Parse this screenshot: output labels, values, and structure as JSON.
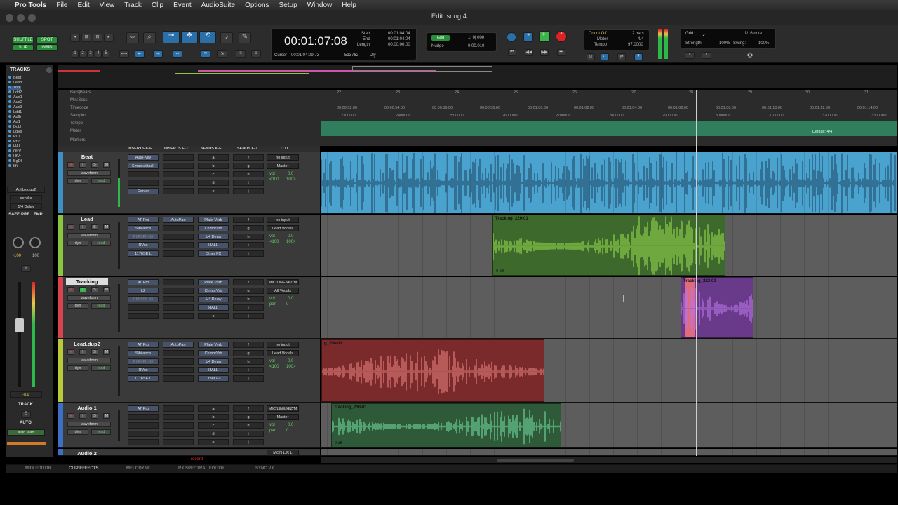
{
  "menubar": {
    "app_name": "Pro Tools",
    "items": [
      "File",
      "Edit",
      "View",
      "Track",
      "Clip",
      "Event",
      "AudioSuite",
      "Options",
      "Setup",
      "Window",
      "Help"
    ]
  },
  "window": {
    "title": "Edit: song 4"
  },
  "toolbar": {
    "shuffle": "SHUFFLE",
    "spot": "SPOT",
    "slip": "SLIP",
    "grid": "GRID",
    "main_counter": "00:01:07:08",
    "start_label": "Start",
    "end_label": "End",
    "length_label": "Length",
    "start": "00:01:04:04",
    "end": "00:01:04:04",
    "length": "00:00:00:00",
    "cursor_label": "Cursor",
    "cursor": "00:01:04:09.73",
    "sample": "513762",
    "dly": "Dly",
    "grid_label": "Grid",
    "grid_value": "1| 0| 000",
    "nudge_label": "Nudge",
    "nudge_value": "0:00.010",
    "count_off": "Count Off",
    "meter_label": "Meter",
    "tempo_label": "Tempo",
    "bars": "2 bars",
    "meter": "4/4",
    "tempo": "97.0000",
    "grid2_label": "Grid:",
    "grid2_value": "1/16 note",
    "strength_label": "Strength:",
    "strength": "100%",
    "swing_label": "Swing:",
    "swing": "100%",
    "nums": [
      "1",
      "2",
      "3",
      "4",
      "5"
    ]
  },
  "tracklist": {
    "header": "TRACKS",
    "items": [
      "Beat",
      "Lead",
      "Trck",
      "Ldd2",
      "Aud1",
      "Aud2",
      "Aud3",
      "Ldd1",
      "Adlb",
      "Ad1",
      "Dobl",
      "LdVs",
      "PCL",
      "PtVr",
      "HAL",
      "OhV",
      "HfVr",
      "BgDl",
      "f/fil"
    ]
  },
  "mixstrip": {
    "name": "Adlibs.dup2",
    "send": "send c",
    "delay": "1/4 Delay",
    "safe": "SAFE",
    "pre": "PRE",
    "fmp": "FMP",
    "pan_l": "-100",
    "pan_r": "100",
    "m": "M",
    "fader_value": "-8.9",
    "track_label": "TRACK",
    "s": "S",
    "auto": "AUTO",
    "auto_read": "auto read"
  },
  "rulers": {
    "labels": [
      "Bars|Beats",
      "Min:Secs",
      "Timecode",
      "Samples",
      "Tempo",
      "Meter",
      "Markers"
    ],
    "bars": [
      "22",
      "23",
      "24",
      "25",
      "26",
      "27",
      "28",
      "29",
      "30",
      "31"
    ],
    "timecode": [
      "00:00:52:00",
      "00:00:54:00",
      "00:00:56:00",
      "00:00:58:00",
      "00:01:00:00",
      "00:01:02:00",
      "00:01:04:00",
      "00:01:06:00",
      "00:01:08:00",
      "00:01:10:00",
      "00:01:12:00",
      "00:01:14:00"
    ],
    "samples": [
      "2300000",
      "2400000",
      "2500000",
      "2600000",
      "2700000",
      "2800000",
      "2900000",
      "3000000",
      "3100000",
      "3200000",
      "3300000"
    ],
    "meter_default": "Default: 4/4"
  },
  "columns": {
    "inserts_ae": "INSERTS A-E",
    "inserts_fj": "INSERTS F-J",
    "sends_ae": "SENDS A-E",
    "sends_fj": "SENDS F-J",
    "io": "I / O"
  },
  "track_controls": {
    "waveform": "waveform",
    "dyn": "dyn",
    "read": "read",
    "vol": "vol",
    "pan": "pan"
  },
  "tracks": [
    {
      "name": "Beat",
      "color": "#3d8fc4",
      "inserts": [
        "Auto-Key",
        "SmackAttack",
        "",
        "",
        "Center"
      ],
      "inserts_fj": [
        "",
        "",
        "",
        "",
        ""
      ],
      "sends": [
        "a",
        "b",
        "c",
        "d",
        "e"
      ],
      "sends_fj": [
        "f",
        "g",
        "h",
        "i",
        "j"
      ],
      "io_in": "no input",
      "io_out": "Master",
      "vol": "0.0",
      "pan_l": "<100",
      "pan_r": "100>"
    },
    {
      "name": "Lead",
      "color": "#8bc43f",
      "inserts": [
        "AT Pro",
        "Sibilance",
        "PhPhPh-03",
        "RVox",
        "1176SE L"
      ],
      "inserts_fj": [
        "AutoPan",
        "",
        "",
        "",
        ""
      ],
      "sends": [
        "Plate Verb",
        "ChmbrVrb",
        "1/4 Delay",
        "HALL",
        "Other FX"
      ],
      "sends_fj": [
        "f",
        "g",
        "h",
        "i",
        "j"
      ],
      "io_in": "no input",
      "io_out": "Lead Vocals",
      "vol": "0.0",
      "pan_l": "<100",
      "pan_r": "100>"
    },
    {
      "name": "Tracking",
      "color": "#d9434f",
      "inserts": [
        "AT Pro",
        "L2",
        "PhPhPh-03",
        "",
        ""
      ],
      "inserts_fj": [
        "",
        "",
        "",
        "",
        ""
      ],
      "sends": [
        "Plate Verb",
        "ChmbrVrb",
        "1/4 Delay",
        "HALL",
        "e"
      ],
      "sends_fj": [
        "f",
        "g",
        "h",
        "i",
        "j"
      ],
      "io_in": "MIC/LINE/HIZ/M",
      "io_out": "All Vocals",
      "vol": "0.0",
      "pan_l": "pan",
      "pan_r": "0"
    },
    {
      "name": "Lead.dup2",
      "color": "#b9c93a",
      "inserts": [
        "AT Pro",
        "Sibilance",
        "PhPhPh-03",
        "RVox",
        "1176SE L"
      ],
      "inserts_fj": [
        "AutoPan",
        "",
        "",
        "",
        ""
      ],
      "sends": [
        "Plate Verb",
        "ChmbrVrb",
        "1/4 Delay",
        "HALL",
        "Other FX"
      ],
      "sends_fj": [
        "f",
        "g",
        "h",
        "i",
        "j"
      ],
      "io_in": "no input",
      "io_out": "Lead Vocals",
      "vol": "0.0",
      "pan_l": "<100",
      "pan_r": "100>"
    },
    {
      "name": "Audio 1",
      "color": "#3d6fc4",
      "inserts": [
        "AT Pro",
        "",
        "",
        "",
        ""
      ],
      "inserts_fj": [
        "",
        "",
        "",
        "",
        ""
      ],
      "sends": [
        "a",
        "b",
        "c",
        "d",
        "e"
      ],
      "sends_fj": [
        "f",
        "g",
        "h",
        "i",
        "j"
      ],
      "io_in": "MIC/LINE/HIZ/M",
      "io_out": "Master",
      "vol": "0.0",
      "pan_l": "pan",
      "pan_r": "0"
    },
    {
      "name": "Audio 2",
      "color": "#3d6fc4",
      "inserts": [
        "",
        "",
        "",
        "",
        ""
      ],
      "inserts_fj": [
        "",
        "",
        "",
        "",
        ""
      ],
      "sends": [
        "a",
        "",
        "",
        "",
        ""
      ],
      "sends_fj": [
        "f",
        "",
        "",
        "",
        ""
      ],
      "io_in": "MON L/R L",
      "io_out": "",
      "vol": "",
      "pan_l": "",
      "pan_r": "",
      "record_label": "record"
    }
  ],
  "clips": [
    {
      "name": "Tracking_220-01",
      "gain": "0 dB"
    },
    {
      "name": "Tracking_222-01",
      "gain": ""
    },
    {
      "name": "g_208-01",
      "gain": ""
    },
    {
      "name": "Tracking_218-01",
      "gain": "0 dB"
    }
  ],
  "bottom_tabs": [
    "MIDI EDITOR",
    "CLIP EFFECTS",
    "MELODYNE",
    "RX SPECTRAL EDITOR",
    "SYNC VX"
  ],
  "colors": {
    "beat_clip": "#4aa3cf",
    "lead_clip": "#3d6a2c",
    "lead_wave": "#8fd24a",
    "tracking_clip": "#6a3a8a",
    "tracking_wave": "#b774e6",
    "leaddup_clip": "#7a2a2a",
    "leaddup_wave": "#e07a7a",
    "audio1_clip": "#2e5a3a",
    "audio1_wave": "#6ed19a"
  }
}
